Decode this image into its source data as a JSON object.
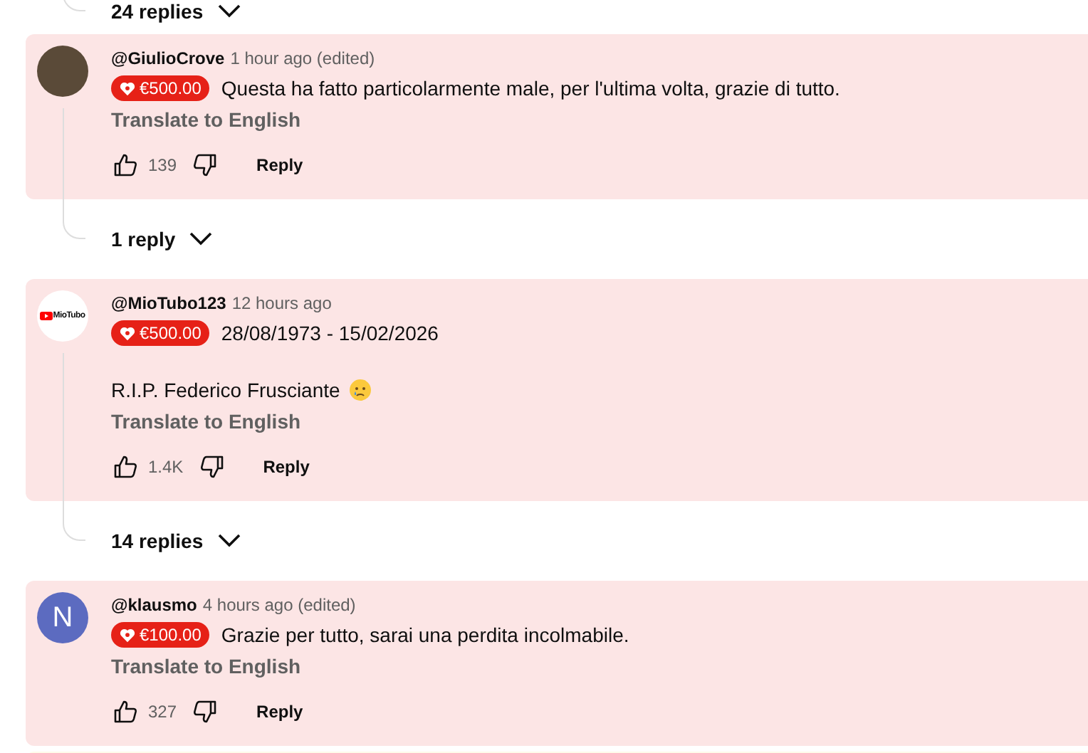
{
  "previous_thread": {
    "replies_toggle": "24 replies"
  },
  "comments": [
    {
      "avatar": {
        "kind": "photo"
      },
      "author": "@GiulioCrove",
      "time": "1 hour ago (edited)",
      "donation": "€500.00",
      "paragraphs": [
        {
          "text": "Questa ha fatto particolarmente male, per l'ultima volta, grazie di tutto."
        }
      ],
      "translate": "Translate to English",
      "likes": "139",
      "reply": "Reply",
      "replies_toggle": "1 reply"
    },
    {
      "avatar": {
        "kind": "logo",
        "text": "MioTubo"
      },
      "author": "@MioTubo123",
      "time": "12 hours ago",
      "donation": "€500.00",
      "paragraphs": [
        {
          "text": "28/08/1973 - 15/02/2026"
        },
        {
          "text": "R.I.P. Federico Frusciante",
          "has_emoji": true
        }
      ],
      "translate": "Translate to English",
      "likes": "1.4K",
      "reply": "Reply",
      "replies_toggle": "14 replies"
    },
    {
      "avatar": {
        "kind": "letter",
        "text": "N",
        "color": "#5c6bc0"
      },
      "author": "@klausmo",
      "time": "4 hours ago (edited)",
      "donation": "€100.00",
      "paragraphs": [
        {
          "text": "Grazie per tutto, sarai una perdita incolmabile."
        }
      ],
      "translate": "Translate to English",
      "likes": "327",
      "reply": "Reply"
    }
  ]
}
